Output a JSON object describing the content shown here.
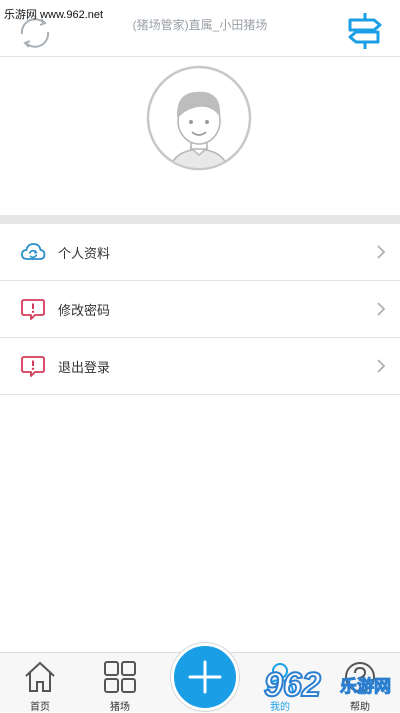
{
  "header": {
    "watermark": "乐游网 www.962.net",
    "title": "(猪场管家)直属_小田猪场"
  },
  "menu": [
    {
      "label": "个人资料",
      "icon": "cloud-sync-icon"
    },
    {
      "label": "修改密码",
      "icon": "alert-bubble-icon"
    },
    {
      "label": "退出登录",
      "icon": "alert-bubble-icon"
    }
  ],
  "nav": {
    "home": "首页",
    "farm": "猪场",
    "mine": "我的",
    "help": "帮助"
  },
  "logo": {
    "brand": "962",
    "site": "乐游网"
  },
  "colors": {
    "accent": "#1a9fe6",
    "icon_blue": "#2b8fc9",
    "icon_red": "#d43b5a"
  }
}
